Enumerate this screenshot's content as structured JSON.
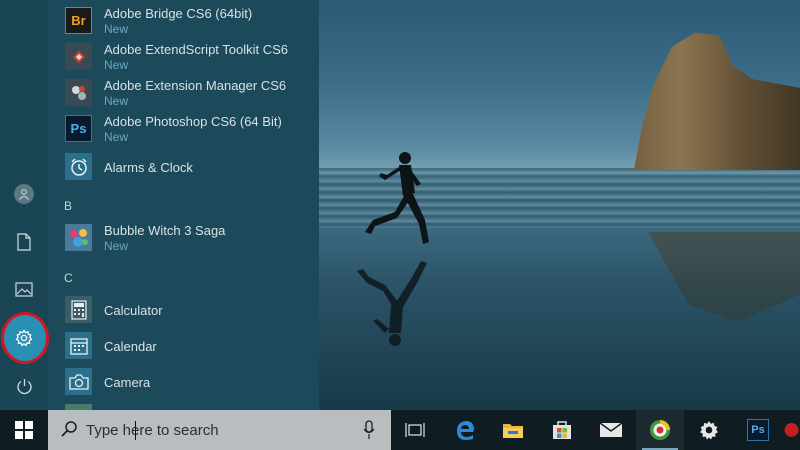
{
  "start_menu": {
    "rail": {
      "user_icon": "user-icon",
      "documents_icon": "document-icon",
      "pictures_icon": "picture-icon",
      "settings_icon": "gear-icon",
      "power_icon": "power-icon",
      "highlight_color": "#d01820"
    },
    "apps": [
      {
        "name": "Adobe Bridge CS6 (64bit)",
        "badge": "New",
        "icon": "bridge-icon",
        "icon_text": "Br"
      },
      {
        "name": "Adobe ExtendScript Toolkit CS6",
        "badge": "New",
        "icon": "extendscript-icon"
      },
      {
        "name": "Adobe Extension Manager CS6",
        "badge": "New",
        "icon": "extension-manager-icon"
      },
      {
        "name": "Adobe Photoshop CS6 (64 Bit)",
        "badge": "New",
        "icon": "photoshop-icon",
        "icon_text": "Ps"
      },
      {
        "name": "Alarms & Clock",
        "icon": "clock-icon"
      }
    ],
    "section_b": "B",
    "apps_b": [
      {
        "name": "Bubble Witch 3 Saga",
        "badge": "New",
        "icon": "bubble-witch-icon"
      }
    ],
    "section_c": "C",
    "apps_c": [
      {
        "name": "Calculator",
        "icon": "calculator-icon"
      },
      {
        "name": "Calendar",
        "icon": "calendar-icon"
      },
      {
        "name": "Camera",
        "icon": "camera-icon"
      }
    ]
  },
  "taskbar": {
    "start_icon": "windows-logo-icon",
    "search": {
      "placeholder": "Type here to search",
      "icon": "search-icon",
      "mic_icon": "microphone-icon"
    },
    "pinned": [
      {
        "icon": "task-view-icon"
      },
      {
        "icon": "edge-icon"
      },
      {
        "icon": "file-explorer-icon"
      },
      {
        "icon": "store-icon"
      },
      {
        "icon": "mail-icon"
      },
      {
        "icon": "app-circle-icon"
      },
      {
        "icon": "gear-icon"
      },
      {
        "icon": "photoshop-icon",
        "icon_text": "Ps"
      },
      {
        "icon": "red-app-icon"
      }
    ]
  },
  "colors": {
    "menu_bg": "#1d4a5a",
    "new_badge": "#6ba7c4",
    "taskbar_bg": "#0f1c22",
    "search_bg": "#b8bdbf"
  }
}
